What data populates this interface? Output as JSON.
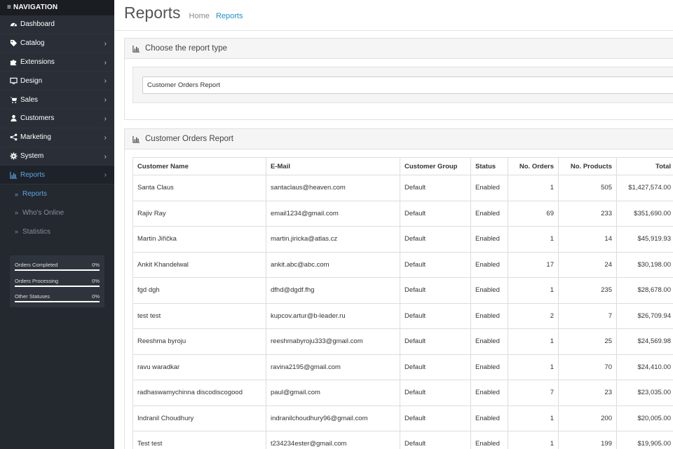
{
  "nav": {
    "header": "NAVIGATION",
    "items": [
      {
        "label": "Dashboard",
        "icon": "dashboard-icon",
        "chevron": false
      },
      {
        "label": "Catalog",
        "icon": "tags-icon",
        "chevron": true
      },
      {
        "label": "Extensions",
        "icon": "puzzle-icon",
        "chevron": true
      },
      {
        "label": "Design",
        "icon": "monitor-icon",
        "chevron": true
      },
      {
        "label": "Sales",
        "icon": "cart-icon",
        "chevron": true
      },
      {
        "label": "Customers",
        "icon": "user-icon",
        "chevron": true
      },
      {
        "label": "Marketing",
        "icon": "share-icon",
        "chevron": true
      },
      {
        "label": "System",
        "icon": "cog-icon",
        "chevron": true
      },
      {
        "label": "Reports",
        "icon": "bar-chart-icon",
        "chevron": true
      }
    ],
    "subitems": [
      {
        "label": "Reports",
        "active": true
      },
      {
        "label": "Who's Online",
        "active": false
      },
      {
        "label": "Statistics",
        "active": false
      }
    ],
    "stats": [
      {
        "label": "Orders Completed",
        "value": "0%",
        "progress": 0
      },
      {
        "label": "Orders Processing",
        "value": "0%",
        "progress": 0
      },
      {
        "label": "Other Statuses",
        "value": "0%",
        "progress": 0
      }
    ]
  },
  "header": {
    "title": "Reports",
    "breadcrumb": [
      "Home",
      "Reports"
    ]
  },
  "report_type_panel": {
    "heading": "Choose the report type",
    "selected": "Customer Orders Report"
  },
  "report_panel": {
    "heading": "Customer Orders Report",
    "columns": [
      "Customer Name",
      "E-Mail",
      "Customer Group",
      "Status",
      "No. Orders",
      "No. Products",
      "Total"
    ],
    "rows": [
      [
        "Santa Claus",
        "santaclaus@heaven.com",
        "Default",
        "Enabled",
        "1",
        "505",
        "$1,427,574.00"
      ],
      [
        "Rajiv Ray",
        "email1234@gmail.com",
        "Default",
        "Enabled",
        "69",
        "233",
        "$351,690.00"
      ],
      [
        "Martin Jiřička",
        "martin.jiricka@atlas.cz",
        "Default",
        "Enabled",
        "1",
        "14",
        "$45,919.93"
      ],
      [
        "Ankit Khandelwal",
        "ankit.abc@abc.com",
        "Default",
        "Enabled",
        "17",
        "24",
        "$30,198.00"
      ],
      [
        "fgd dgh",
        "dfhd@dgdf.fhg",
        "Default",
        "Enabled",
        "1",
        "235",
        "$28,678.00"
      ],
      [
        "test test",
        "kupcov.artur@b-leader.ru",
        "Default",
        "Enabled",
        "2",
        "7",
        "$26,709.94"
      ],
      [
        "Reeshma byroju",
        "reeshmabyroju333@gmail.com",
        "Default",
        "Enabled",
        "1",
        "25",
        "$24,569.98"
      ],
      [
        "ravu waradkar",
        "ravina2195@gmail.com",
        "Default",
        "Enabled",
        "1",
        "70",
        "$24,410.00"
      ],
      [
        "radhaswamychinna discodiscogood",
        "paul@gmail.com",
        "Default",
        "Enabled",
        "7",
        "23",
        "$23,035.00"
      ],
      [
        "Indranil Choudhury",
        "indranilchoudhury96@gmail.com",
        "Default",
        "Enabled",
        "1",
        "200",
        "$20,005.00"
      ],
      [
        "Test test",
        "t234234ester@gmail.com",
        "Default",
        "Enabled",
        "1",
        "199",
        "$19,905.00"
      ]
    ]
  }
}
